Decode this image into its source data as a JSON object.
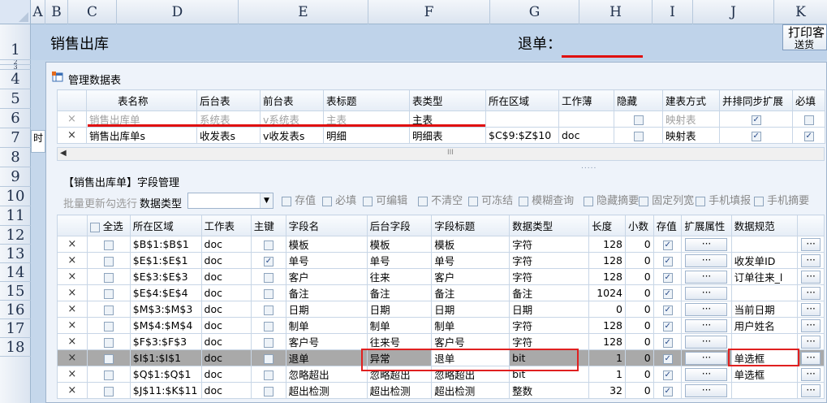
{
  "columns": [
    "A",
    "B",
    "C",
    "D",
    "E",
    "F",
    "G",
    "H",
    "I",
    "J",
    "K"
  ],
  "rows": [
    "1",
    "2",
    "3",
    "4",
    "5",
    "6",
    "7",
    "8",
    "9",
    "10",
    "11",
    "12",
    "13",
    "14",
    "15",
    "16",
    "17",
    "18"
  ],
  "header": {
    "title": "销售出库",
    "return_label": "退单：",
    "print_btn_line1": "打印客",
    "print_btn_line2": "送货",
    "row6_stub": "时"
  },
  "panel": {
    "title": "管理数据表",
    "hscroll_mark": "III",
    "splitter_dots": "....."
  },
  "table1": {
    "headers": [
      "",
      "表名称",
      "后台表",
      "前台表",
      "表标题",
      "表类型",
      "所在区域",
      "工作薄",
      "隐藏",
      "建表方式",
      "并排同步扩展",
      "必填"
    ],
    "rows": [
      {
        "x": "×",
        "name": "销售出库单",
        "back": "系统表",
        "front": "v系统表",
        "title": "主表",
        "type": "主表",
        "region": "",
        "book": "",
        "hidden": false,
        "method": "映射表",
        "sync": true,
        "required": false
      },
      {
        "x": "×",
        "name": "销售出库单s",
        "back": "收发表s",
        "front": "v收发表s",
        "title": "明细",
        "type": "明细表",
        "region": "$C$9:$Z$10",
        "book": "doc",
        "hidden": false,
        "method": "映射表",
        "sync": true,
        "required": true
      }
    ]
  },
  "fields_section": {
    "title": "【销售出库单】字段管理",
    "batch_label": "批量更新勾选行",
    "datatype_label": "数据类型",
    "dropdown_value": "",
    "checks": [
      "存值",
      "必填",
      "可编辑",
      "不清空",
      "可冻结",
      "模糊查询",
      "隐藏摘要",
      "固定列宽",
      "手机填报",
      "手机摘要"
    ]
  },
  "table2": {
    "headers": [
      "",
      "全选",
      "所在区域",
      "工作表",
      "主键",
      "字段名",
      "后台字段",
      "字段标题",
      "数据类型",
      "长度",
      "小数",
      "存值",
      "扩展属性",
      "数据规范",
      ""
    ],
    "ext_label": "···",
    "rows": [
      {
        "x": "×",
        "chk": false,
        "region": "$B$1:$B$1",
        "sheet": "doc",
        "key": false,
        "name": "模板",
        "back": "模板",
        "title": "模板",
        "dtype": "字符",
        "len": "128",
        "dec": "0",
        "store": true,
        "spec": ""
      },
      {
        "x": "×",
        "chk": false,
        "region": "$E$1:$E$1",
        "sheet": "doc",
        "key": true,
        "name": "单号",
        "back": "单号",
        "title": "单号",
        "dtype": "字符",
        "len": "128",
        "dec": "0",
        "store": true,
        "spec": "收发单ID"
      },
      {
        "x": "×",
        "chk": false,
        "region": "$E$3:$E$3",
        "sheet": "doc",
        "key": false,
        "name": "客户",
        "back": "往来",
        "title": "客户",
        "dtype": "字符",
        "len": "128",
        "dec": "0",
        "store": true,
        "spec": "订单往来_l"
      },
      {
        "x": "×",
        "chk": false,
        "region": "$E$4:$E$4",
        "sheet": "doc",
        "key": false,
        "name": "备注",
        "back": "备注",
        "title": "备注",
        "dtype": "备注",
        "len": "1024",
        "dec": "0",
        "store": true,
        "spec": ""
      },
      {
        "x": "×",
        "chk": false,
        "region": "$M$3:$M$3",
        "sheet": "doc",
        "key": false,
        "name": "日期",
        "back": "日期",
        "title": "日期",
        "dtype": "日期",
        "len": "0",
        "dec": "0",
        "store": true,
        "spec": "当前日期"
      },
      {
        "x": "×",
        "chk": false,
        "region": "$M$4:$M$4",
        "sheet": "doc",
        "key": false,
        "name": "制单",
        "back": "制单",
        "title": "制单",
        "dtype": "字符",
        "len": "128",
        "dec": "0",
        "store": true,
        "spec": "用户姓名"
      },
      {
        "x": "×",
        "chk": false,
        "region": "$F$3:$F$3",
        "sheet": "doc",
        "key": false,
        "name": "客户号",
        "back": "往来号",
        "title": "客户号",
        "dtype": "字符",
        "len": "128",
        "dec": "0",
        "store": true,
        "spec": ""
      },
      {
        "x": "×",
        "chk": false,
        "region": "$I$1:$I$1",
        "sheet": "doc",
        "key": false,
        "name": "退单",
        "back": "异常",
        "title": "退单",
        "dtype": "bit",
        "len": "1",
        "dec": "0",
        "store": true,
        "spec": "单选框"
      },
      {
        "x": "×",
        "chk": false,
        "region": "$Q$1:$Q$1",
        "sheet": "doc",
        "key": false,
        "name": "忽略超出",
        "back": "忽略超出",
        "title": "忽略超出",
        "dtype": "bit",
        "len": "1",
        "dec": "0",
        "store": true,
        "spec": "单选框"
      },
      {
        "x": "×",
        "chk": false,
        "region": "$J$11:$K$11",
        "sheet": "doc",
        "key": false,
        "name": "超出检测",
        "back": "超出检测",
        "title": "超出检测",
        "dtype": "整数",
        "len": "32",
        "dec": "0",
        "store": true,
        "spec": ""
      }
    ]
  },
  "colors": {
    "accent_red": "#e01010",
    "header_bg": "#dbe4f0",
    "selected_row": "#a9a9a9"
  }
}
